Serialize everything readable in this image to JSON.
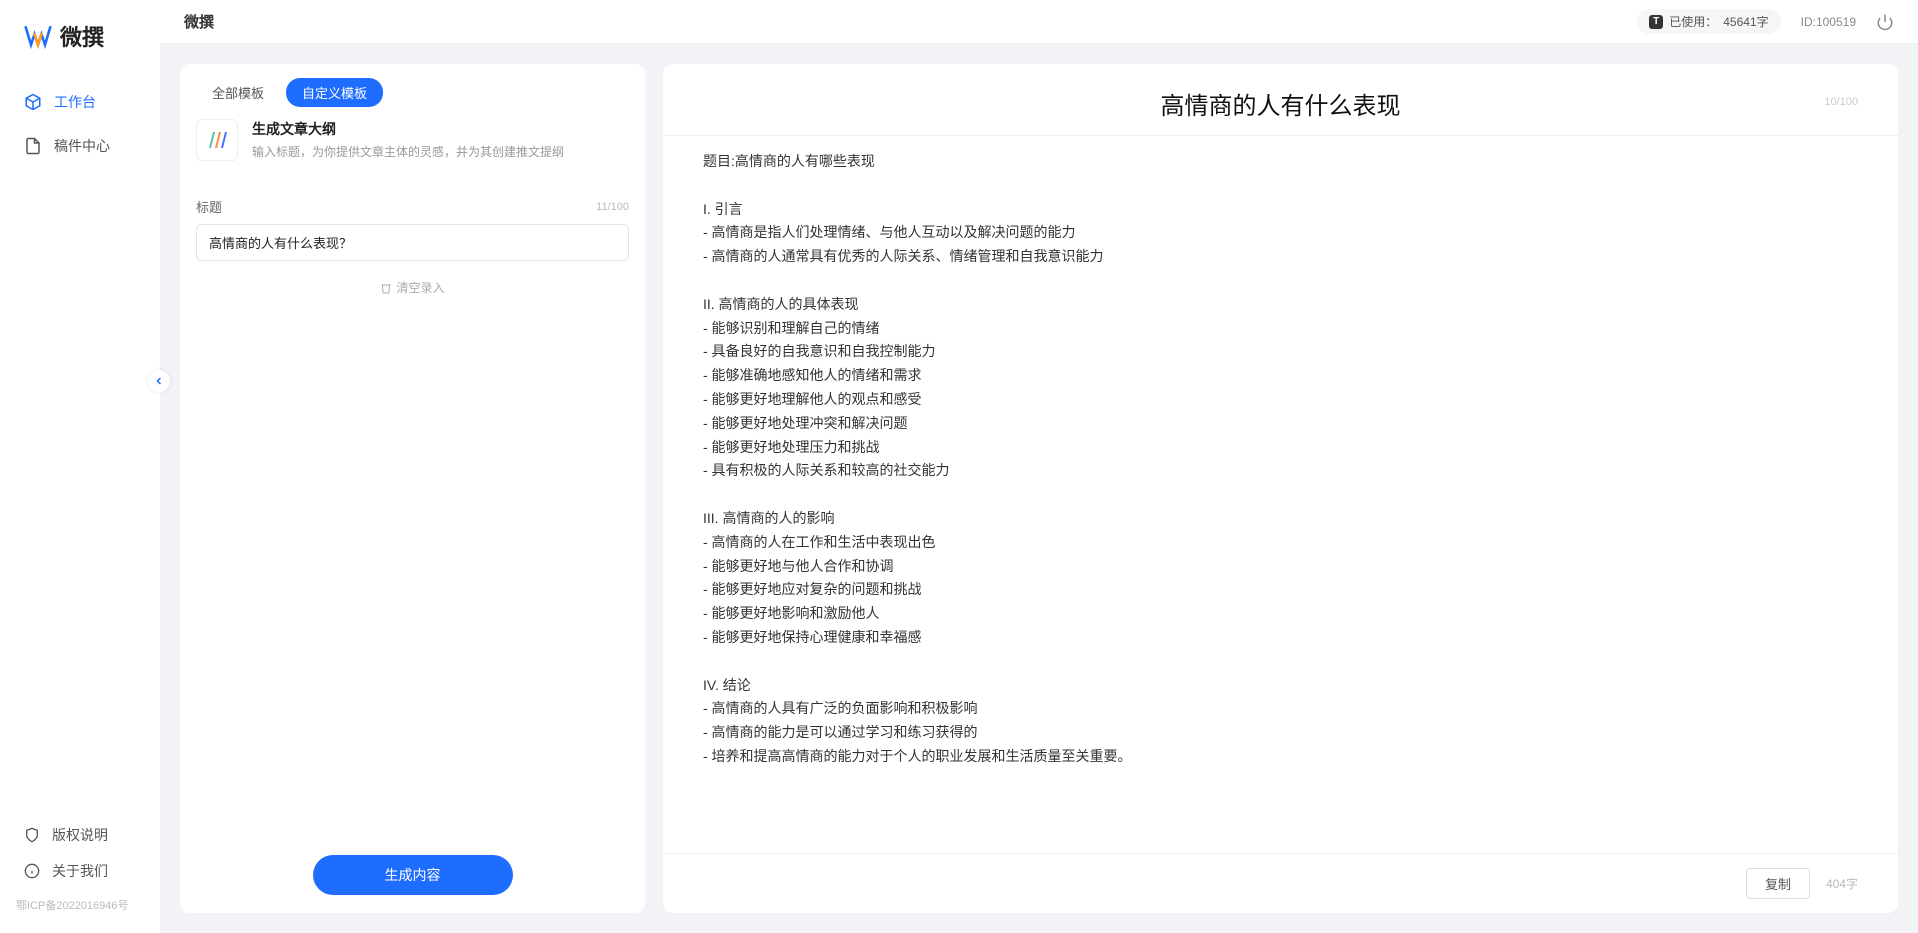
{
  "app": {
    "name": "微撰"
  },
  "sidebar": {
    "nav": [
      {
        "label": "工作台",
        "active": true
      },
      {
        "label": "稿件中心",
        "active": false
      }
    ],
    "footer": [
      {
        "label": "版权说明"
      },
      {
        "label": "关于我们"
      }
    ],
    "icp": "鄂ICP备2022016946号"
  },
  "topbar": {
    "title": "微撰",
    "usage": {
      "prefix": "已使用：",
      "value": "45641字"
    },
    "user_id": "ID:100519"
  },
  "tabs": {
    "all": "全部模板",
    "custom": "自定义模板"
  },
  "template": {
    "title": "生成文章大纲",
    "desc": "输入标题，为你提供文章主体的灵感，并为其创建推文提纲"
  },
  "field": {
    "label": "标题",
    "count": "11/100",
    "value": "高情商的人有什么表现？"
  },
  "clear": "清空录入",
  "generate": "生成内容",
  "output": {
    "title": "高情商的人有什么表现",
    "title_count": "10/100",
    "body": "题目:高情商的人有哪些表现\n\nI. 引言\n- 高情商是指人们处理情绪、与他人互动以及解决问题的能力\n- 高情商的人通常具有优秀的人际关系、情绪管理和自我意识能力\n\nII. 高情商的人的具体表现\n- 能够识别和理解自己的情绪\n- 具备良好的自我意识和自我控制能力\n- 能够准确地感知他人的情绪和需求\n- 能够更好地理解他人的观点和感受\n- 能够更好地处理冲突和解决问题\n- 能够更好地处理压力和挑战\n- 具有积极的人际关系和较高的社交能力\n\nIII. 高情商的人的影响\n- 高情商的人在工作和生活中表现出色\n- 能够更好地与他人合作和协调\n- 能够更好地应对复杂的问题和挑战\n- 能够更好地影响和激励他人\n- 能够更好地保持心理健康和幸福感\n\nIV. 结论\n- 高情商的人具有广泛的负面影响和积极影响\n- 高情商的能力是可以通过学习和练习获得的\n- 培养和提高高情商的能力对于个人的职业发展和生活质量至关重要。",
    "copy": "复制",
    "word_count": "404字"
  }
}
